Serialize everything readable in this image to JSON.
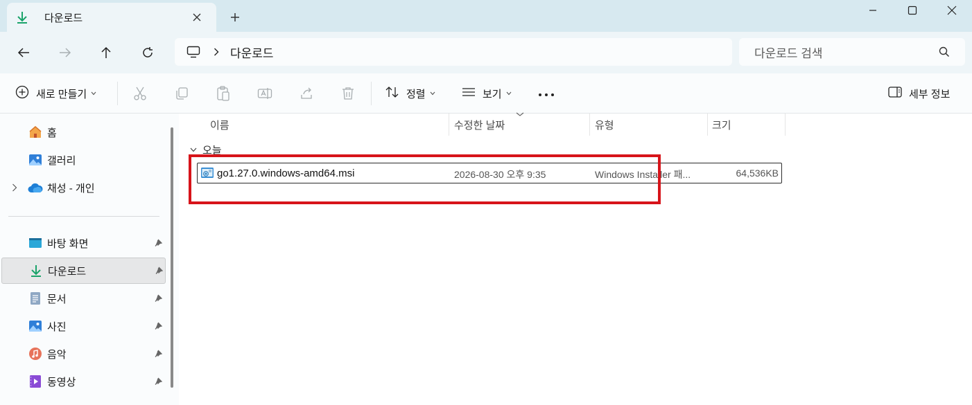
{
  "window": {
    "tab_title": "다운로드",
    "colors": {
      "titlebar_bg": "#d7e9f0",
      "accent_green": "#1aa36a",
      "highlight_red": "#d7141a"
    }
  },
  "address": {
    "crumb": "다운로드",
    "search_placeholder": "다운로드 검색"
  },
  "toolbar": {
    "new_label": "새로 만들기",
    "sort_label": "정렬",
    "view_label": "보기",
    "more_label": "•••",
    "details_label": "세부 정보",
    "icons": [
      "cut-icon",
      "copy-icon",
      "paste-icon",
      "rename-icon",
      "share-icon",
      "delete-icon"
    ]
  },
  "sidebar": {
    "top_items": [
      {
        "label": "홈",
        "icon": "home-icon"
      },
      {
        "label": "갤러리",
        "icon": "gallery-icon"
      },
      {
        "label": "채성 - 개인",
        "icon": "onedrive-icon"
      }
    ],
    "quick_access": [
      {
        "label": "바탕 화면",
        "icon": "desktop-icon"
      },
      {
        "label": "다운로드",
        "icon": "downloads-icon"
      },
      {
        "label": "문서",
        "icon": "documents-icon"
      },
      {
        "label": "사진",
        "icon": "pictures-icon"
      },
      {
        "label": "음악",
        "icon": "music-icon"
      },
      {
        "label": "동영상",
        "icon": "videos-icon"
      }
    ]
  },
  "content": {
    "columns": {
      "name": "이름",
      "modified": "수정한 날짜",
      "type": "유형",
      "size": "크기"
    },
    "group_label": "오늘",
    "files": [
      {
        "name": "go1.27.0.windows-amd64.msi",
        "modified": "2026-08-30 오후 9:35",
        "type": "Windows Installer 패...",
        "size": "64,536KB"
      }
    ]
  }
}
